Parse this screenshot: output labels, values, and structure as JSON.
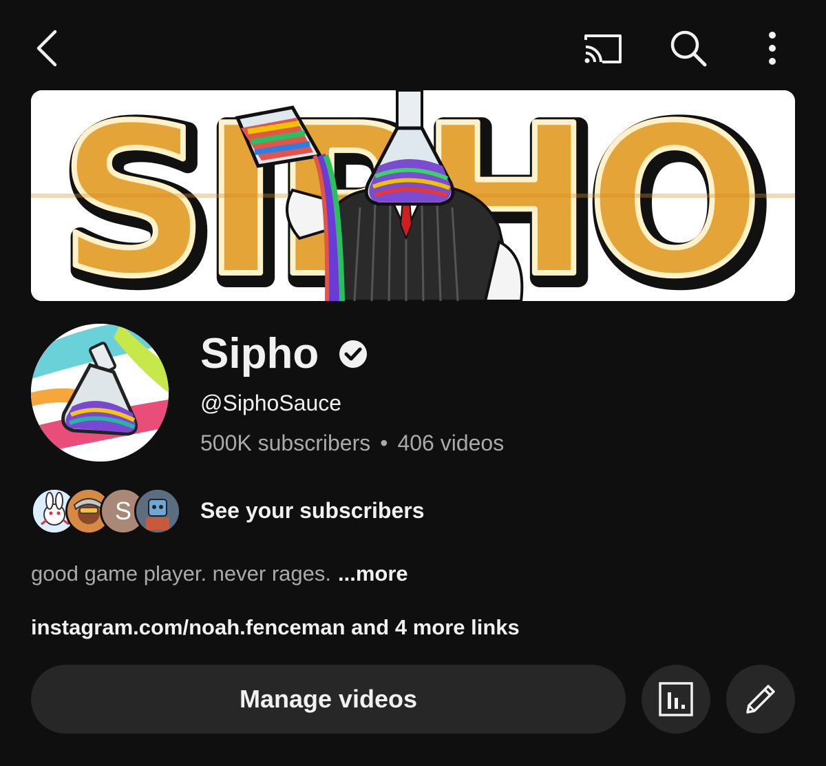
{
  "top_bar": {
    "icons": [
      "back-icon",
      "cast-icon",
      "search-icon",
      "more-vert-icon"
    ]
  },
  "banner": {
    "text": "SIPHO"
  },
  "channel": {
    "name": "Sipho",
    "handle": "@SiphoSauce",
    "subscribers": "500K subscribers",
    "separator": "•",
    "videos": "406 videos"
  },
  "subscribers_preview": {
    "label": "See your subscribers",
    "initial": "S"
  },
  "description": {
    "text": "good game player. never rages.",
    "more_label": "...more"
  },
  "links": {
    "text": "instagram.com/noah.fenceman and 4 more links"
  },
  "actions": {
    "manage_label": "Manage videos"
  },
  "colors": {
    "background": "#0f0f0f",
    "button_bg": "#272727",
    "text_primary": "#f1f1f1",
    "text_secondary": "#aaaaaa",
    "banner_gold": "#e5a437"
  }
}
